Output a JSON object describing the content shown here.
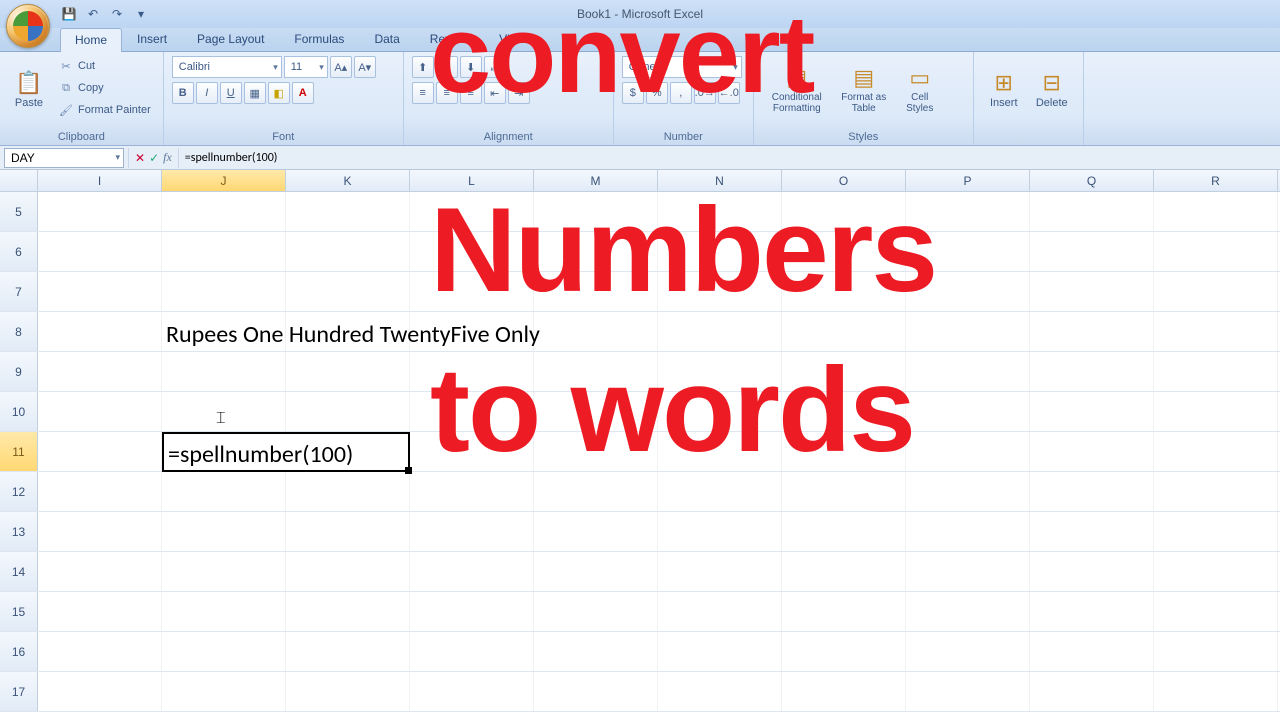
{
  "title": "Book1 - Microsoft Excel",
  "tabs": [
    "Home",
    "Insert",
    "Page Layout",
    "Formulas",
    "Data",
    "Review",
    "View"
  ],
  "active_tab": 0,
  "ribbon": {
    "clipboard": {
      "label": "Clipboard",
      "paste": "Paste",
      "cut": "Cut",
      "copy": "Copy",
      "painter": "Format Painter"
    },
    "font": {
      "label": "Font",
      "name": "Calibri",
      "size": "11"
    },
    "alignment": {
      "label": "Alignment"
    },
    "number": {
      "label": "Number",
      "format": "General"
    },
    "styles": {
      "label": "Styles",
      "cond": "Conditional Formatting",
      "table": "Format as Table",
      "cell": "Cell Styles"
    },
    "cells": {
      "insert": "Insert",
      "delete": "Delete"
    }
  },
  "fbar": {
    "name": "DAY",
    "formula": "=spellnumber(100)"
  },
  "columns": [
    "I",
    "J",
    "K",
    "L",
    "M",
    "N",
    "O",
    "P",
    "Q",
    "R"
  ],
  "active_col": 1,
  "rows": [
    5,
    6,
    7,
    8,
    9,
    10,
    11,
    12,
    13,
    14,
    15,
    16,
    17
  ],
  "active_row_value": 11,
  "content": {
    "cell_J8": "Rupees One Hundred TwentyFive Only",
    "cell_J11": "=spellnumber(100)"
  },
  "overlay": {
    "line1": "convert",
    "line2": "Numbers",
    "line3": "to words"
  }
}
